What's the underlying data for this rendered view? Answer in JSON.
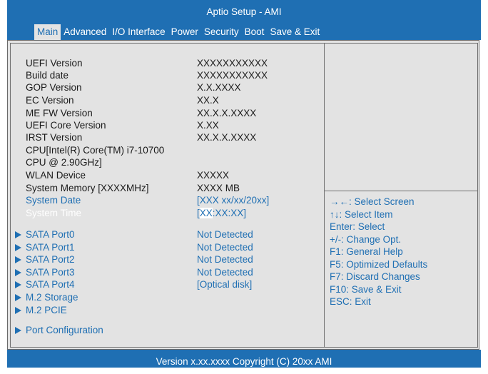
{
  "header": {
    "title": "Aptio Setup - AMI",
    "tabs": [
      "Main",
      "Advanced",
      "I/O Interface",
      "Power",
      "Security",
      "Boot",
      "Save & Exit"
    ]
  },
  "info": [
    {
      "label": "UEFI Version",
      "value": "XXXXXXXXXXX"
    },
    {
      "label": "Build date",
      "value": "XXXXXXXXXXX"
    },
    {
      "label": "GOP Version",
      "value": "X.X.XXXX"
    },
    {
      "label": "EC Version",
      "value": "XX.X"
    },
    {
      "label": "ME FW Version",
      "value": "XX.X.X.XXXX"
    },
    {
      "label": "UEFI Core Version",
      "value": "X.XX"
    },
    {
      "label": "IRST Version",
      "value": "XX.X.X.XXXX"
    },
    {
      "label": "CPU[Intel(R) Core(TM) i7-10700",
      "value": ""
    },
    {
      "label": "CPU @ 2.90GHz]",
      "value": ""
    },
    {
      "label": "WLAN Device",
      "value": "XXXXX"
    },
    {
      "label": "System Memory [XXXXMHz]",
      "value": "XXXX MB"
    }
  ],
  "system_date": {
    "label": "System Date",
    "value": "[XXX xx/xx/20xx]"
  },
  "system_time": {
    "label": "System Time",
    "open": "[",
    "highlight": "XX",
    "rest": ":XX:XX]"
  },
  "sata": [
    {
      "label": "SATA Port0",
      "value": "Not Detected"
    },
    {
      "label": "SATA Port1",
      "value": "Not Detected"
    },
    {
      "label": "SATA Port2",
      "value": "Not Detected"
    },
    {
      "label": "SATA Port3",
      "value": "Not Detected"
    },
    {
      "label": "SATA Port4",
      "value": "[Optical disk]"
    }
  ],
  "submenus": [
    "M.2 Storage",
    "M.2 PCIE"
  ],
  "port_config": "Port  Configuration",
  "help": [
    "→←: Select Screen",
    "↑↓: Select Item",
    "Enter: Select",
    "+/-: Change Opt.",
    "F1: General Help",
    "F5: Optimized Defaults",
    "F7: Discard Changes",
    "F10: Save & Exit",
    "ESC: Exit"
  ],
  "footer": "Version x.xx.xxxx Copyright (C) 20xx AMI",
  "colors": {
    "accent": "#1f6fb3",
    "panel": "#e3e3e3",
    "text": "#1a1a1a"
  }
}
